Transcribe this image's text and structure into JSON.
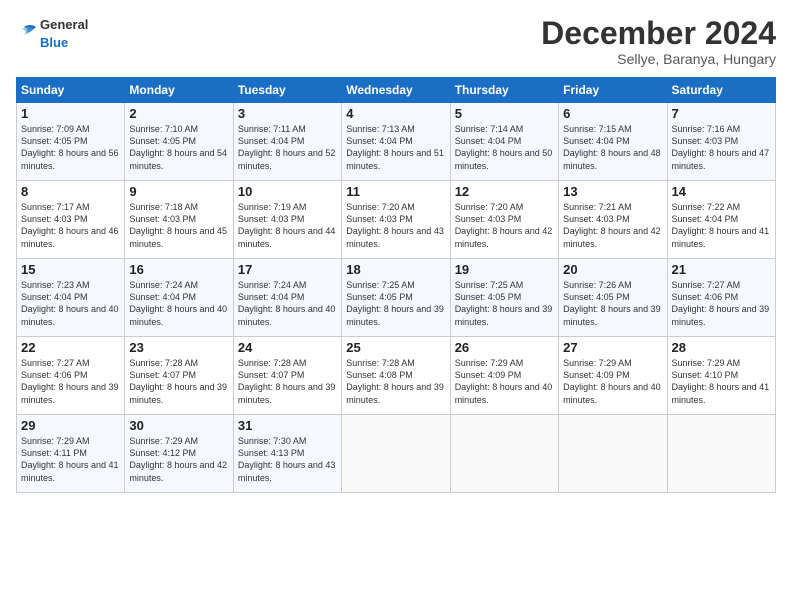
{
  "logo": {
    "line1": "General",
    "line2": "Blue"
  },
  "title": "December 2024",
  "subtitle": "Sellye, Baranya, Hungary",
  "header": {
    "days": [
      "Sunday",
      "Monday",
      "Tuesday",
      "Wednesday",
      "Thursday",
      "Friday",
      "Saturday"
    ]
  },
  "weeks": [
    [
      {
        "day": "1",
        "sunrise": "7:09 AM",
        "sunset": "4:05 PM",
        "daylight": "8 hours and 56 minutes."
      },
      {
        "day": "2",
        "sunrise": "7:10 AM",
        "sunset": "4:05 PM",
        "daylight": "8 hours and 54 minutes."
      },
      {
        "day": "3",
        "sunrise": "7:11 AM",
        "sunset": "4:04 PM",
        "daylight": "8 hours and 52 minutes."
      },
      {
        "day": "4",
        "sunrise": "7:13 AM",
        "sunset": "4:04 PM",
        "daylight": "8 hours and 51 minutes."
      },
      {
        "day": "5",
        "sunrise": "7:14 AM",
        "sunset": "4:04 PM",
        "daylight": "8 hours and 50 minutes."
      },
      {
        "day": "6",
        "sunrise": "7:15 AM",
        "sunset": "4:04 PM",
        "daylight": "8 hours and 48 minutes."
      },
      {
        "day": "7",
        "sunrise": "7:16 AM",
        "sunset": "4:03 PM",
        "daylight": "8 hours and 47 minutes."
      }
    ],
    [
      {
        "day": "8",
        "sunrise": "7:17 AM",
        "sunset": "4:03 PM",
        "daylight": "8 hours and 46 minutes."
      },
      {
        "day": "9",
        "sunrise": "7:18 AM",
        "sunset": "4:03 PM",
        "daylight": "8 hours and 45 minutes."
      },
      {
        "day": "10",
        "sunrise": "7:19 AM",
        "sunset": "4:03 PM",
        "daylight": "8 hours and 44 minutes."
      },
      {
        "day": "11",
        "sunrise": "7:20 AM",
        "sunset": "4:03 PM",
        "daylight": "8 hours and 43 minutes."
      },
      {
        "day": "12",
        "sunrise": "7:20 AM",
        "sunset": "4:03 PM",
        "daylight": "8 hours and 42 minutes."
      },
      {
        "day": "13",
        "sunrise": "7:21 AM",
        "sunset": "4:03 PM",
        "daylight": "8 hours and 42 minutes."
      },
      {
        "day": "14",
        "sunrise": "7:22 AM",
        "sunset": "4:04 PM",
        "daylight": "8 hours and 41 minutes."
      }
    ],
    [
      {
        "day": "15",
        "sunrise": "7:23 AM",
        "sunset": "4:04 PM",
        "daylight": "8 hours and 40 minutes."
      },
      {
        "day": "16",
        "sunrise": "7:24 AM",
        "sunset": "4:04 PM",
        "daylight": "8 hours and 40 minutes."
      },
      {
        "day": "17",
        "sunrise": "7:24 AM",
        "sunset": "4:04 PM",
        "daylight": "8 hours and 40 minutes."
      },
      {
        "day": "18",
        "sunrise": "7:25 AM",
        "sunset": "4:05 PM",
        "daylight": "8 hours and 39 minutes."
      },
      {
        "day": "19",
        "sunrise": "7:25 AM",
        "sunset": "4:05 PM",
        "daylight": "8 hours and 39 minutes."
      },
      {
        "day": "20",
        "sunrise": "7:26 AM",
        "sunset": "4:05 PM",
        "daylight": "8 hours and 39 minutes."
      },
      {
        "day": "21",
        "sunrise": "7:27 AM",
        "sunset": "4:06 PM",
        "daylight": "8 hours and 39 minutes."
      }
    ],
    [
      {
        "day": "22",
        "sunrise": "7:27 AM",
        "sunset": "4:06 PM",
        "daylight": "8 hours and 39 minutes."
      },
      {
        "day": "23",
        "sunrise": "7:28 AM",
        "sunset": "4:07 PM",
        "daylight": "8 hours and 39 minutes."
      },
      {
        "day": "24",
        "sunrise": "7:28 AM",
        "sunset": "4:07 PM",
        "daylight": "8 hours and 39 minutes."
      },
      {
        "day": "25",
        "sunrise": "7:28 AM",
        "sunset": "4:08 PM",
        "daylight": "8 hours and 39 minutes."
      },
      {
        "day": "26",
        "sunrise": "7:29 AM",
        "sunset": "4:09 PM",
        "daylight": "8 hours and 40 minutes."
      },
      {
        "day": "27",
        "sunrise": "7:29 AM",
        "sunset": "4:09 PM",
        "daylight": "8 hours and 40 minutes."
      },
      {
        "day": "28",
        "sunrise": "7:29 AM",
        "sunset": "4:10 PM",
        "daylight": "8 hours and 41 minutes."
      }
    ],
    [
      {
        "day": "29",
        "sunrise": "7:29 AM",
        "sunset": "4:11 PM",
        "daylight": "8 hours and 41 minutes."
      },
      {
        "day": "30",
        "sunrise": "7:29 AM",
        "sunset": "4:12 PM",
        "daylight": "8 hours and 42 minutes."
      },
      {
        "day": "31",
        "sunrise": "7:30 AM",
        "sunset": "4:13 PM",
        "daylight": "8 hours and 43 minutes."
      },
      null,
      null,
      null,
      null
    ]
  ],
  "labels": {
    "sunrise": "Sunrise:",
    "sunset": "Sunset:",
    "daylight": "Daylight:"
  }
}
